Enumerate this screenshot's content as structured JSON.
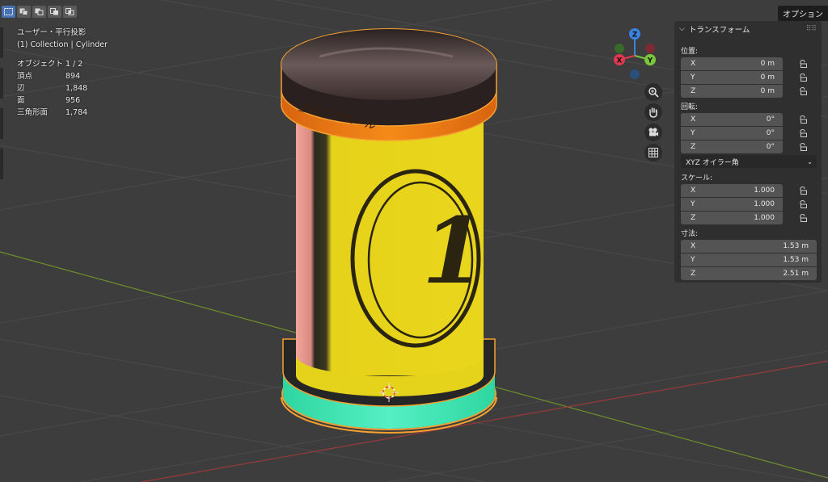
{
  "toolbar": {
    "select_modes": [
      "select-box-icon",
      "select-extend-icon",
      "select-subtract-icon",
      "select-invert-icon",
      "select-intersect-icon"
    ],
    "options_label": "オプション"
  },
  "overlay": {
    "view_label": "ユーザー・平行投影",
    "collection_label": "(1) Collection | Cylinder"
  },
  "stats": [
    {
      "label": "オブジェクト",
      "value": "1 / 2"
    },
    {
      "label": "頂点",
      "value": "894"
    },
    {
      "label": "辺",
      "value": "1,848"
    },
    {
      "label": "面",
      "value": "956"
    },
    {
      "label": "三角形面",
      "value": "1,784"
    }
  ],
  "gizmo": {
    "x": "X",
    "y": "Y",
    "z": "Z"
  },
  "model": {
    "label_text": "上のスクロール",
    "number": "1"
  },
  "npanel": {
    "title": "トランスフォーム",
    "location": {
      "label": "位置:",
      "x": "0 m",
      "y": "0 m",
      "z": "0 m"
    },
    "rotation": {
      "label": "回転:",
      "x": "0°",
      "y": "0°",
      "z": "0°"
    },
    "rotation_mode": "XYZ オイラー角",
    "scale": {
      "label": "スケール:",
      "x": "1.000",
      "y": "1.000",
      "z": "1.000"
    },
    "dimensions": {
      "label": "寸法:",
      "x": "1.53 m",
      "y": "1.53 m",
      "z": "2.51 m"
    },
    "axis_x": "X",
    "axis_y": "Y",
    "axis_z": "Z"
  },
  "colors": {
    "background": "#3d3d3d",
    "selection_outline": "#f5a030",
    "label_yellow": "#e8d81a",
    "cap_orange": "#f07a10",
    "base_teal": "#33e6b0",
    "x_axis": "#e0394f",
    "y_axis": "#7ac63a",
    "z_axis": "#3a83e0"
  }
}
